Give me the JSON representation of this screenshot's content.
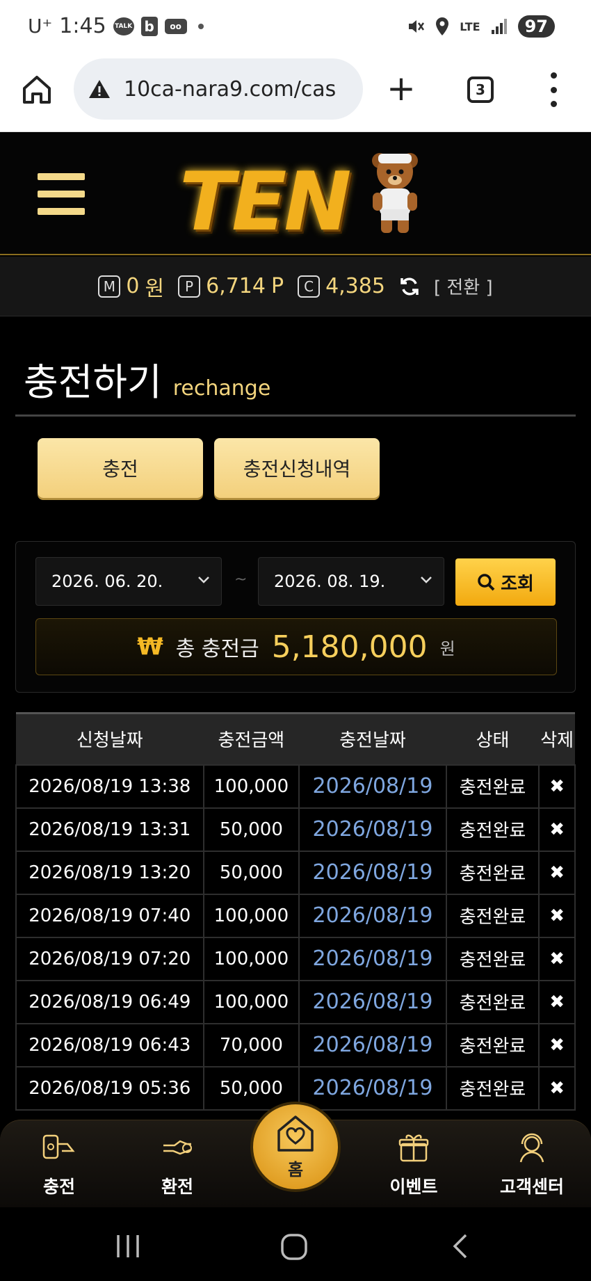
{
  "status_bar": {
    "carrier": "U⁺",
    "time": "1:45",
    "network": "LTE",
    "battery": "97"
  },
  "browser": {
    "url": "10ca-nara9.com/cas",
    "tab_count": "3"
  },
  "header": {
    "logo_text": "TEN"
  },
  "points": {
    "money_badge": "M",
    "money_value": "0",
    "money_unit": "원",
    "point_badge": "P",
    "point_value": "6,714",
    "point_unit": "P",
    "coin_badge": "C",
    "coin_value": "4,385",
    "swap_label": "[ 전환 ]"
  },
  "page": {
    "title": "충전하기",
    "subtitle": "rechange"
  },
  "tabs": {
    "charge": "충전",
    "history": "충전신청내역"
  },
  "search": {
    "start_date": "2026. 06. 20.",
    "separator": "~",
    "end_date": "2026. 08. 19.",
    "button": "조회"
  },
  "total": {
    "currency_symbol": "₩",
    "label": "총 충전금",
    "amount": "5,180,000",
    "unit": "원"
  },
  "table": {
    "headers": [
      "신청날짜",
      "충전금액",
      "충전날짜",
      "상태",
      "삭제"
    ],
    "rows": [
      {
        "requested": "2026/08/19 13:38",
        "amount": "100,000",
        "charged": "2026/08/19",
        "status": "충전완료",
        "delete": "✖"
      },
      {
        "requested": "2026/08/19 13:31",
        "amount": "50,000",
        "charged": "2026/08/19",
        "status": "충전완료",
        "delete": "✖"
      },
      {
        "requested": "2026/08/19 13:20",
        "amount": "50,000",
        "charged": "2026/08/19",
        "status": "충전완료",
        "delete": "✖"
      },
      {
        "requested": "2026/08/19 07:40",
        "amount": "100,000",
        "charged": "2026/08/19",
        "status": "충전완료",
        "delete": "✖"
      },
      {
        "requested": "2026/08/19 07:20",
        "amount": "100,000",
        "charged": "2026/08/19",
        "status": "충전완료",
        "delete": "✖"
      },
      {
        "requested": "2026/08/19 06:49",
        "amount": "100,000",
        "charged": "2026/08/19",
        "status": "충전완료",
        "delete": "✖"
      },
      {
        "requested": "2026/08/19 06:43",
        "amount": "70,000",
        "charged": "2026/08/19",
        "status": "충전완료",
        "delete": "✖"
      },
      {
        "requested": "2026/08/19 05:36",
        "amount": "50,000",
        "charged": "2026/08/19",
        "status": "충전완료",
        "delete": "✖"
      }
    ]
  },
  "bottom_nav": {
    "charge": "충전",
    "exchange": "환전",
    "home": "홈",
    "event": "이벤트",
    "support": "고객센터"
  },
  "colors": {
    "accent_gold": "#f3d07c",
    "link_blue": "#7fa7e0",
    "background": "#000000"
  },
  "icons": [
    "home-icon",
    "warning-icon",
    "plus-icon",
    "tabs-icon",
    "more-icon",
    "hamburger-icon",
    "refresh-icon",
    "search-icon",
    "delete-icon",
    "charge-icon",
    "exchange-icon",
    "heart-home-icon",
    "gift-icon",
    "support-icon"
  ]
}
